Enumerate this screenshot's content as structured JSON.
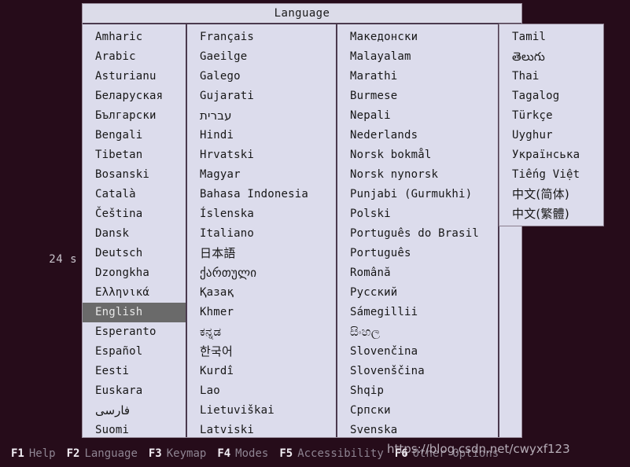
{
  "screen": {
    "background_color": "#260c1a",
    "countdown": "24 s"
  },
  "dialog": {
    "title": "Language",
    "background_color": "#dcdcec",
    "border_color": "#4b3a4e",
    "selected_bg_color": "#6a6a6a",
    "columns": [
      {
        "items": [
          {
            "label": "Amharic",
            "selected": false,
            "script": "latin"
          },
          {
            "label": "Arabic",
            "selected": false,
            "script": "latin"
          },
          {
            "label": "Asturianu",
            "selected": false,
            "script": "latin"
          },
          {
            "label": "Беларуская",
            "selected": false,
            "script": "latin"
          },
          {
            "label": "Български",
            "selected": false,
            "script": "latin"
          },
          {
            "label": "Bengali",
            "selected": false,
            "script": "latin"
          },
          {
            "label": "Tibetan",
            "selected": false,
            "script": "latin"
          },
          {
            "label": "Bosanski",
            "selected": false,
            "script": "latin"
          },
          {
            "label": "Català",
            "selected": false,
            "script": "latin"
          },
          {
            "label": "Čeština",
            "selected": false,
            "script": "latin"
          },
          {
            "label": "Dansk",
            "selected": false,
            "script": "latin"
          },
          {
            "label": "Deutsch",
            "selected": false,
            "script": "latin"
          },
          {
            "label": "Dzongkha",
            "selected": false,
            "script": "latin"
          },
          {
            "label": "Ελληνικά",
            "selected": false,
            "script": "latin"
          },
          {
            "label": "English",
            "selected": true,
            "script": "latin"
          },
          {
            "label": "Esperanto",
            "selected": false,
            "script": "latin"
          },
          {
            "label": "Español",
            "selected": false,
            "script": "latin"
          },
          {
            "label": "Eesti",
            "selected": false,
            "script": "latin"
          },
          {
            "label": "Euskara",
            "selected": false,
            "script": "latin"
          },
          {
            "label": "فارسی",
            "selected": false,
            "script": "other"
          },
          {
            "label": "Suomi",
            "selected": false,
            "script": "latin"
          }
        ]
      },
      {
        "items": [
          {
            "label": "Français",
            "selected": false,
            "script": "latin"
          },
          {
            "label": "Gaeilge",
            "selected": false,
            "script": "latin"
          },
          {
            "label": "Galego",
            "selected": false,
            "script": "latin"
          },
          {
            "label": "Gujarati",
            "selected": false,
            "script": "latin"
          },
          {
            "label": "עברית",
            "selected": false,
            "script": "other"
          },
          {
            "label": "Hindi",
            "selected": false,
            "script": "latin"
          },
          {
            "label": "Hrvatski",
            "selected": false,
            "script": "latin"
          },
          {
            "label": "Magyar",
            "selected": false,
            "script": "latin"
          },
          {
            "label": "Bahasa Indonesia",
            "selected": false,
            "script": "latin"
          },
          {
            "label": "Íslenska",
            "selected": false,
            "script": "latin"
          },
          {
            "label": "Italiano",
            "selected": false,
            "script": "latin"
          },
          {
            "label": "日本語",
            "selected": false,
            "script": "cjk"
          },
          {
            "label": "ქართული",
            "selected": false,
            "script": "other"
          },
          {
            "label": "Қазақ",
            "selected": false,
            "script": "latin"
          },
          {
            "label": "Khmer",
            "selected": false,
            "script": "latin"
          },
          {
            "label": "ಕನ್ನಡ",
            "selected": false,
            "script": "other"
          },
          {
            "label": "한국어",
            "selected": false,
            "script": "cjk"
          },
          {
            "label": "Kurdî",
            "selected": false,
            "script": "latin"
          },
          {
            "label": "Lao",
            "selected": false,
            "script": "latin"
          },
          {
            "label": "Lietuviškai",
            "selected": false,
            "script": "latin"
          },
          {
            "label": "Latviski",
            "selected": false,
            "script": "latin"
          }
        ]
      },
      {
        "items": [
          {
            "label": "Македонски",
            "selected": false,
            "script": "latin"
          },
          {
            "label": "Malayalam",
            "selected": false,
            "script": "latin"
          },
          {
            "label": "Marathi",
            "selected": false,
            "script": "latin"
          },
          {
            "label": "Burmese",
            "selected": false,
            "script": "latin"
          },
          {
            "label": "Nepali",
            "selected": false,
            "script": "latin"
          },
          {
            "label": "Nederlands",
            "selected": false,
            "script": "latin"
          },
          {
            "label": "Norsk bokmål",
            "selected": false,
            "script": "latin"
          },
          {
            "label": "Norsk nynorsk",
            "selected": false,
            "script": "latin"
          },
          {
            "label": "Punjabi (Gurmukhi)",
            "selected": false,
            "script": "latin"
          },
          {
            "label": "Polski",
            "selected": false,
            "script": "latin"
          },
          {
            "label": "Português do Brasil",
            "selected": false,
            "script": "latin"
          },
          {
            "label": "Português",
            "selected": false,
            "script": "latin"
          },
          {
            "label": "Română",
            "selected": false,
            "script": "latin"
          },
          {
            "label": "Русский",
            "selected": false,
            "script": "latin"
          },
          {
            "label": "Sámegillii",
            "selected": false,
            "script": "latin"
          },
          {
            "label": "සිංහල",
            "selected": false,
            "script": "other"
          },
          {
            "label": "Slovenčina",
            "selected": false,
            "script": "latin"
          },
          {
            "label": "Slovenščina",
            "selected": false,
            "script": "latin"
          },
          {
            "label": "Shqip",
            "selected": false,
            "script": "latin"
          },
          {
            "label": "Српски",
            "selected": false,
            "script": "latin"
          },
          {
            "label": "Svenska",
            "selected": false,
            "script": "latin"
          }
        ]
      }
    ],
    "overflow_column": {
      "items": [
        {
          "label": "Tamil",
          "selected": false,
          "script": "latin"
        },
        {
          "label": "తెలుగు",
          "selected": false,
          "script": "other"
        },
        {
          "label": "Thai",
          "selected": false,
          "script": "latin"
        },
        {
          "label": "Tagalog",
          "selected": false,
          "script": "latin"
        },
        {
          "label": "Türkçe",
          "selected": false,
          "script": "latin"
        },
        {
          "label": "Uyghur",
          "selected": false,
          "script": "latin"
        },
        {
          "label": "Українська",
          "selected": false,
          "script": "latin"
        },
        {
          "label": "Tiếng Việt",
          "selected": false,
          "script": "latin"
        },
        {
          "label": "中文(简体)",
          "selected": false,
          "script": "cjk"
        },
        {
          "label": "中文(繁體)",
          "selected": false,
          "script": "cjk"
        }
      ]
    }
  },
  "function_keys": [
    {
      "key": "F1",
      "label": "Help"
    },
    {
      "key": "F2",
      "label": "Language"
    },
    {
      "key": "F3",
      "label": "Keymap"
    },
    {
      "key": "F4",
      "label": "Modes"
    },
    {
      "key": "F5",
      "label": "Accessibility"
    },
    {
      "key": "F6",
      "label": "Other Options"
    }
  ],
  "watermark": {
    "text": "https://blog.csdn.net/cwyxf123"
  }
}
